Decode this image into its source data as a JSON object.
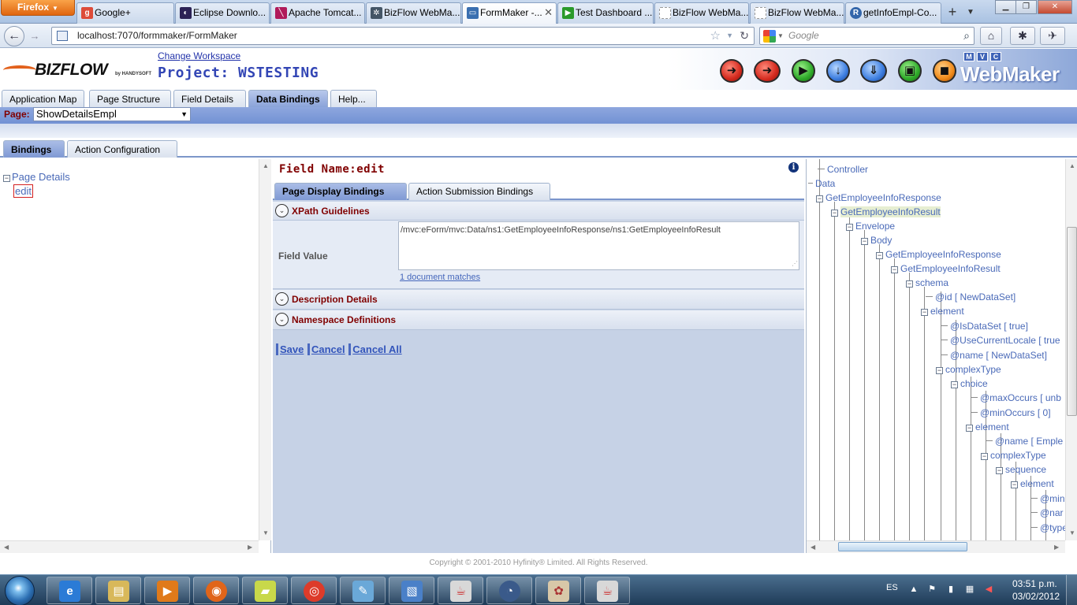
{
  "browser": {
    "app_button": "Firefox",
    "tabs": [
      {
        "title": "Google+",
        "icon": "google-plus-icon",
        "color": "#dd4b39",
        "glyph": "g+"
      },
      {
        "title": "Eclipse Downlo...",
        "icon": "eclipse-icon",
        "color": "#2c2255",
        "glyph": "◐"
      },
      {
        "title": "Apache Tomcat...",
        "icon": "tomcat-feather-icon",
        "color": "#b01a5a",
        "glyph": "╲"
      },
      {
        "title": "BizFlow WebMa...",
        "icon": "gear-icon",
        "color": "#445566",
        "glyph": "✲"
      },
      {
        "title": "FormMaker -...",
        "icon": "page-icon",
        "color": "#3a6fb0",
        "glyph": "▭"
      },
      {
        "title": "Test Dashboard ...",
        "icon": "play-icon",
        "color": "#2a9a2a",
        "glyph": "▶"
      },
      {
        "title": "BizFlow WebMa...",
        "icon": "blank-page-icon",
        "color": "#999999",
        "glyph": ""
      },
      {
        "title": "BizFlow WebMa...",
        "icon": "blank-page-icon",
        "color": "#999999",
        "glyph": ""
      },
      {
        "title": "getInfoEmpl-Co...",
        "icon": "r-icon",
        "color": "#3366aa",
        "glyph": "R"
      }
    ],
    "url": "localhost:7070/formmaker/FormMaker",
    "search_placeholder": "Google"
  },
  "app": {
    "logo_text": "BIZFLOW",
    "logo_sub": "by HANDYSOFT",
    "change_workspace": "Change Workspace",
    "project_title": "Project: WSTESTING",
    "toolbar_buttons": [
      {
        "name": "exit-red-icon",
        "color": "red",
        "glyph": "➜"
      },
      {
        "name": "exit-red-alt-icon",
        "color": "red",
        "glyph": "➜"
      },
      {
        "name": "run-green-icon",
        "color": "green",
        "glyph": "▶"
      },
      {
        "name": "download-blue-icon",
        "color": "blue",
        "glyph": "↓"
      },
      {
        "name": "deploy-blue-icon",
        "color": "blue",
        "glyph": "⇓"
      },
      {
        "name": "preview-green-icon",
        "color": "green",
        "glyph": "▣"
      },
      {
        "name": "stop-orange-icon",
        "color": "orange",
        "glyph": "◼"
      }
    ],
    "brand_mvc": [
      "M",
      "V",
      "C"
    ],
    "brand_name": "WebMaker"
  },
  "main_tabs": [
    {
      "label": "Application Map",
      "active": false
    },
    {
      "label": "Page Structure",
      "active": false
    },
    {
      "label": "Field Details",
      "active": false
    },
    {
      "label": "Data Bindings",
      "active": true
    },
    {
      "label": "Help...",
      "active": false
    }
  ],
  "page_selector": {
    "label": "Page:",
    "value": "ShowDetailsEmpl"
  },
  "sub_tabs": [
    {
      "label": "Bindings",
      "active": true
    },
    {
      "label": "Action Configuration",
      "active": false
    }
  ],
  "left_tree": {
    "root": "Page Details",
    "child": "edit"
  },
  "center": {
    "field_name": "Field Name:edit",
    "binding_tabs": [
      {
        "label": "Page Display Bindings",
        "active": true
      },
      {
        "label": "Action Submission Bindings",
        "active": false
      }
    ],
    "xpath_title": "XPath Guidelines",
    "field_value_label": "Field Value",
    "field_value": "/mvc:eForm/mvc:Data/ns1:GetEmployeeInfoResponse/ns1:GetEmployeeInfoResult",
    "doc_matches": "1 document matches",
    "description_title": "Description Details",
    "namespace_title": "Namespace Definitions",
    "actions": {
      "save": "Save",
      "cancel": "Cancel",
      "cancel_all": "Cancel All"
    }
  },
  "right_tree": [
    {
      "label": "Controller",
      "attr": ""
    },
    {
      "label": "Data",
      "attr": ""
    },
    {
      "label": "GetEmployeeInfoResponse",
      "attr": ""
    },
    {
      "label": "GetEmployeeInfoResult",
      "attr": ""
    },
    {
      "label": "Envelope",
      "attr": ""
    },
    {
      "label": "Body",
      "attr": ""
    },
    {
      "label": "GetEmployeeInfoResponse",
      "attr": ""
    },
    {
      "label": "GetEmployeeInfoResult",
      "attr": ""
    },
    {
      "label": "schema",
      "attr": ""
    },
    {
      "label": "@id",
      "attr": "[ NewDataSet]"
    },
    {
      "label": "element",
      "attr": ""
    },
    {
      "label": "@IsDataSet",
      "attr": "[ true]"
    },
    {
      "label": "@UseCurrentLocale",
      "attr": "[ true"
    },
    {
      "label": "@name",
      "attr": "[ NewDataSet]"
    },
    {
      "label": "complexType",
      "attr": ""
    },
    {
      "label": "choice",
      "attr": ""
    },
    {
      "label": "@maxOccurs",
      "attr": "[ unb"
    },
    {
      "label": "@minOccurs",
      "attr": "[ 0]"
    },
    {
      "label": "element",
      "attr": ""
    },
    {
      "label": "@name",
      "attr": "[ Emple"
    },
    {
      "label": "complexType",
      "attr": ""
    },
    {
      "label": "sequence",
      "attr": ""
    },
    {
      "label": "element",
      "attr": ""
    },
    {
      "label": "@min",
      "attr": ""
    },
    {
      "label": "@nar",
      "attr": ""
    },
    {
      "label": "@type",
      "attr": ""
    }
  ],
  "footer": "Copyright © 2001-2010 Hyfinity® Limited. All Rights Reserved.",
  "taskbar": {
    "apps": [
      {
        "name": "internet-explorer-icon",
        "color": "#2b7bd6",
        "glyph": "e"
      },
      {
        "name": "file-explorer-icon",
        "color": "#d8b85a",
        "glyph": "▤"
      },
      {
        "name": "media-player-icon",
        "color": "#e07a1a",
        "glyph": "▶"
      },
      {
        "name": "firefox-icon",
        "color": "#e0651a",
        "glyph": "◉"
      },
      {
        "name": "sticky-notes-icon",
        "color": "#c8d84a",
        "glyph": "▰"
      },
      {
        "name": "chrome-icon",
        "color": "#dd3b2a",
        "glyph": "◎"
      },
      {
        "name": "notepad-icon",
        "color": "#6aa8d8",
        "glyph": "✎"
      },
      {
        "name": "image-viewer-icon",
        "color": "#4a80c8",
        "glyph": "▧"
      },
      {
        "name": "java-icon",
        "color": "#d8d8d8",
        "glyph": "☕"
      },
      {
        "name": "network-icon",
        "color": "#3a5a8a",
        "glyph": "◔"
      },
      {
        "name": "paint-icon",
        "color": "#d8c8a8",
        "glyph": "✿"
      },
      {
        "name": "java-alt-icon",
        "color": "#d8d8d8",
        "glyph": "☕"
      }
    ],
    "language": "ES",
    "time": "03:51 p.m.",
    "date": "03/02/2012"
  }
}
